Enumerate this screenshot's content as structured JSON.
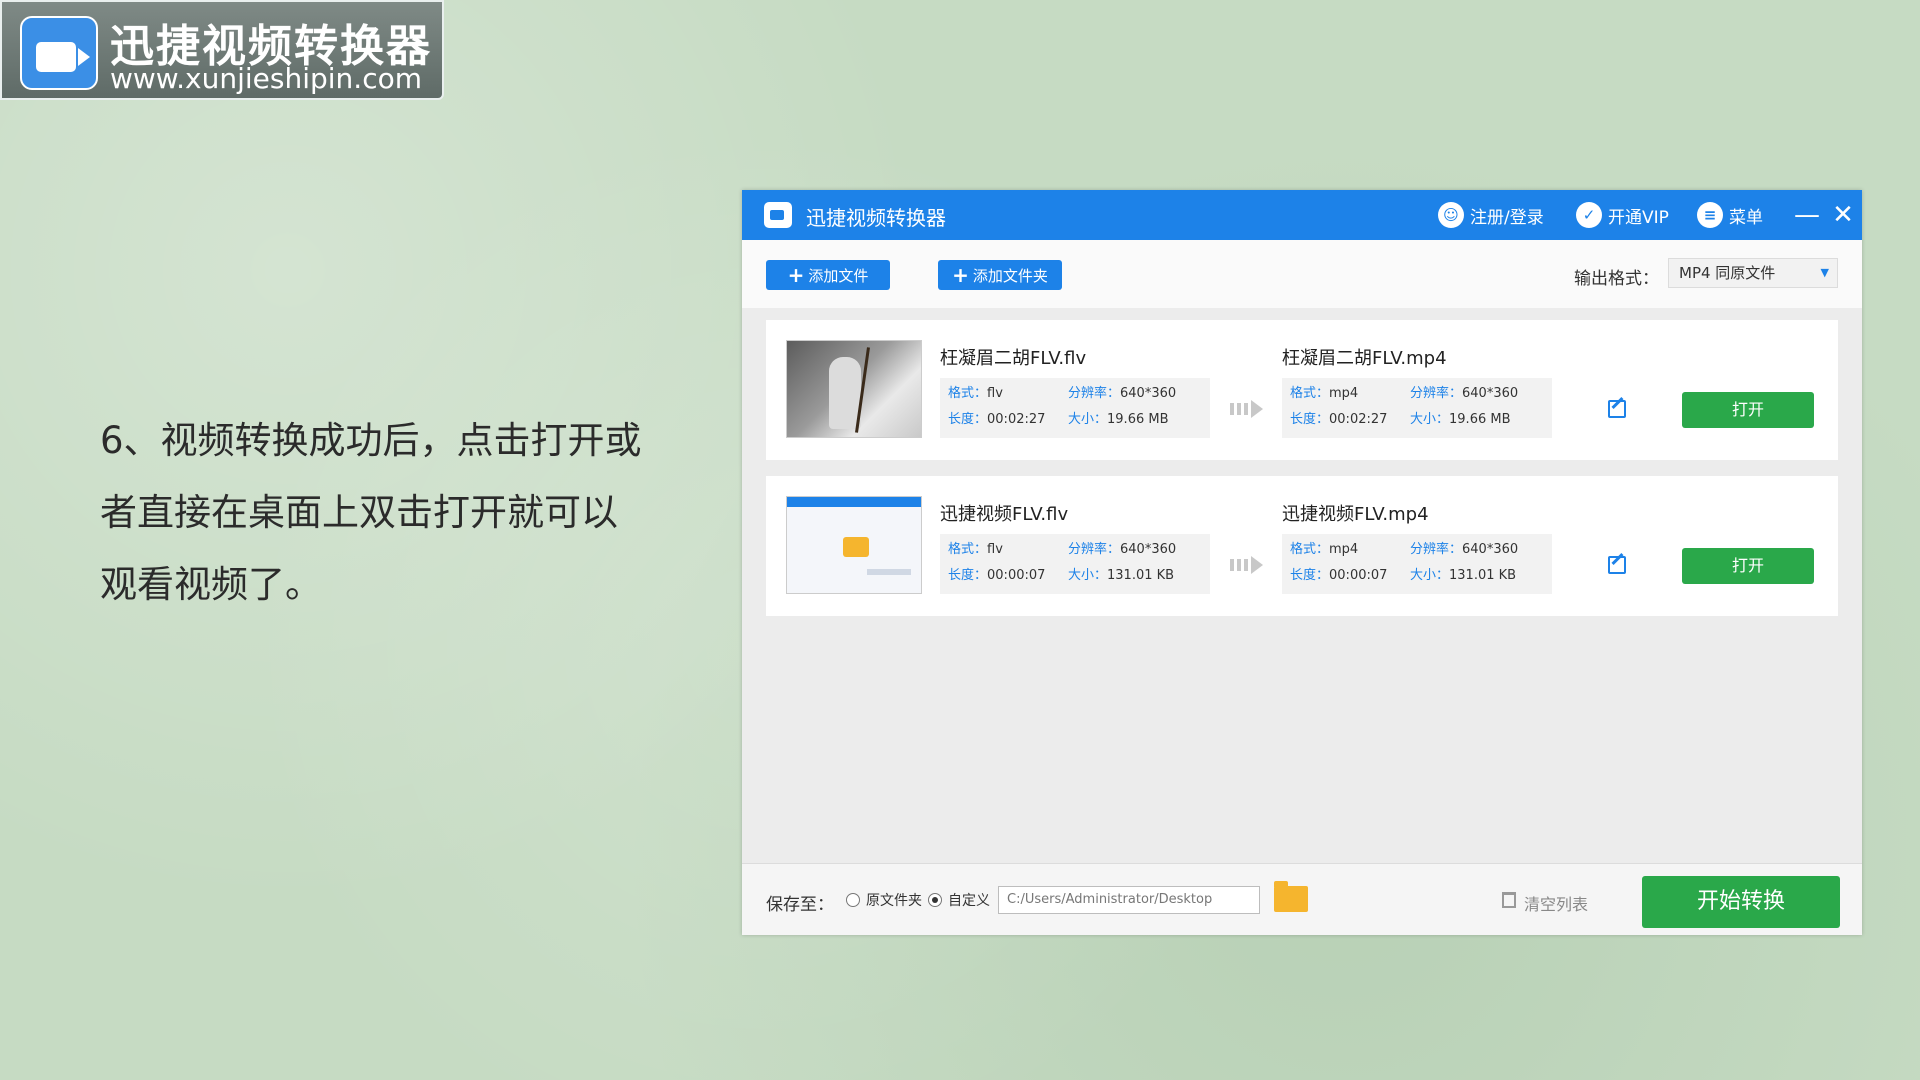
{
  "logo": {
    "title": "迅捷视频转换器",
    "url": "www.xunjieshipin.com"
  },
  "instruction": {
    "line1": "6、视频转换成功后，点击打开或",
    "line2": "者直接在桌面上双击打开就可以",
    "line3": "观看视频了。"
  },
  "app": {
    "title": "迅捷视频转换器",
    "login_label": "注册/登录",
    "vip_label": "开通VIP",
    "menu_label": "菜单",
    "minimize": "—",
    "close": "✕"
  },
  "toolbar": {
    "add_file_label": "添加文件",
    "add_folder_label": "添加文件夹",
    "output_format_label": "输出格式：",
    "output_format_value": "MP4  同原文件"
  },
  "keys": {
    "format": "格式：",
    "resolution": "分辨率：",
    "duration": "长度：",
    "size": "大小："
  },
  "files": [
    {
      "source_name": "枉凝眉二胡FLV.flv",
      "source_format": "flv",
      "source_resolution": "640*360",
      "source_duration": "00:02:27",
      "source_size": "19.66 MB",
      "target_name": "枉凝眉二胡FLV.mp4",
      "target_format": "mp4",
      "target_resolution": "640*360",
      "target_duration": "00:02:27",
      "target_size": "19.66 MB",
      "open_label": "打开"
    },
    {
      "source_name": "迅捷视频FLV.flv",
      "source_format": "flv",
      "source_resolution": "640*360",
      "source_duration": "00:00:07",
      "source_size": "131.01 KB",
      "target_name": "迅捷视频FLV.mp4",
      "target_format": "mp4",
      "target_resolution": "640*360",
      "target_duration": "00:00:07",
      "target_size": "131.01 KB",
      "open_label": "打开"
    }
  ],
  "bottom": {
    "save_to_label": "保存至：",
    "radio_original_label": "原文件夹",
    "radio_custom_label": "自定义",
    "radio_selected": "custom",
    "path_value": "C:/Users/Administrator/Desktop",
    "clear_list_label": "清空列表",
    "start_label": "开始转换"
  },
  "colors": {
    "accent": "#1d82e8",
    "success": "#2aa84a",
    "background": "#c6dbc3"
  }
}
